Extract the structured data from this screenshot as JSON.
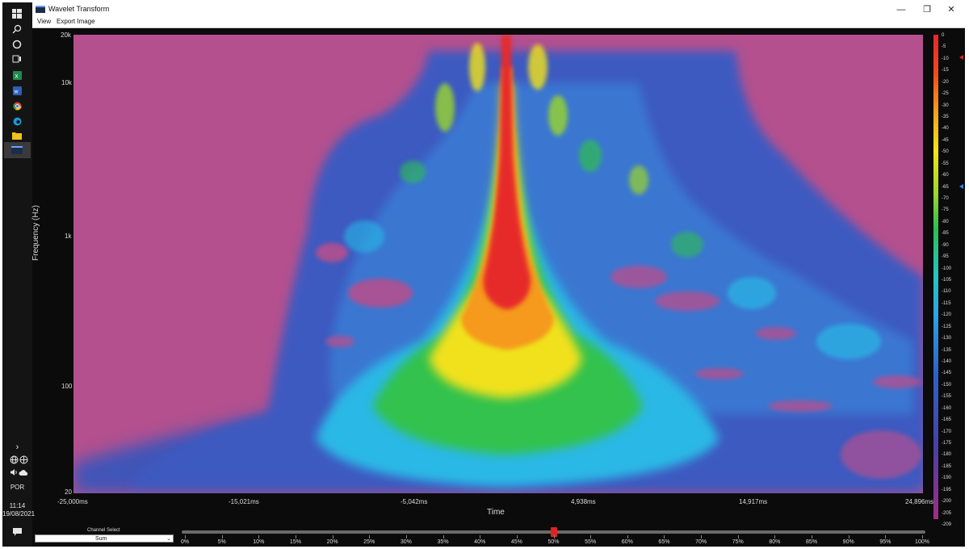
{
  "window": {
    "title": "Wavelet Transform",
    "menu": [
      "View",
      "Export Image"
    ],
    "controls": {
      "minimize": "—",
      "restore": "❐",
      "close": "✕"
    }
  },
  "taskbar": {
    "icons": [
      "windows-icon",
      "search-icon",
      "cortana-icon",
      "task-view-icon",
      "excel-icon",
      "word-icon",
      "chrome-icon",
      "edge-icon",
      "folder-icon",
      "app-wavelet-icon"
    ],
    "tray": {
      "chevron": "›",
      "language": "POR",
      "time": "11:14",
      "date": "19/08/2021"
    }
  },
  "plot": {
    "y_axis_title": "Frequency (Hz)",
    "x_axis_title": "Time",
    "y_ticks": [
      "20k",
      "10k",
      "1k",
      "100",
      "20"
    ],
    "x_ticks": [
      "-25,000ms",
      "-15,021ms",
      "-5,042ms",
      "4,938ms",
      "14,917ms",
      "24,896ms"
    ],
    "colormap": [
      "#e8262a",
      "#f7a01a",
      "#f3e416",
      "#9ad62b",
      "#2fbf4f",
      "#25c4c6",
      "#2aa4e6",
      "#2c62c8",
      "#4a3fa6",
      "#b4508e"
    ]
  },
  "colorbar": {
    "ticks": [
      "0",
      "-5",
      "-10",
      "-15",
      "-20",
      "-25",
      "-30",
      "-35",
      "-40",
      "-45",
      "-50",
      "-55",
      "-60",
      "-65",
      "-70",
      "-75",
      "-80",
      "-85",
      "-90",
      "-95",
      "-100",
      "-105",
      "-110",
      "-115",
      "-120",
      "-125",
      "-130",
      "-135",
      "-140",
      "-145",
      "-150",
      "-155",
      "-160",
      "-165",
      "-170",
      "-175",
      "-180",
      "-185",
      "-190",
      "-195",
      "-200",
      "-205",
      "-209"
    ],
    "upper_marker_color": "#e02222",
    "lower_marker_color": "#3d7bff"
  },
  "controls": {
    "channel_select_label": "Channel Select",
    "channel_select_value": "Sum",
    "position_scale": [
      "0%",
      "5%",
      "10%",
      "15%",
      "20%",
      "25%",
      "30%",
      "35%",
      "40%",
      "45%",
      "50%",
      "55%",
      "60%",
      "65%",
      "70%",
      "75%",
      "80%",
      "85%",
      "90%",
      "95%",
      "100%"
    ],
    "position_value_pct": 50
  }
}
